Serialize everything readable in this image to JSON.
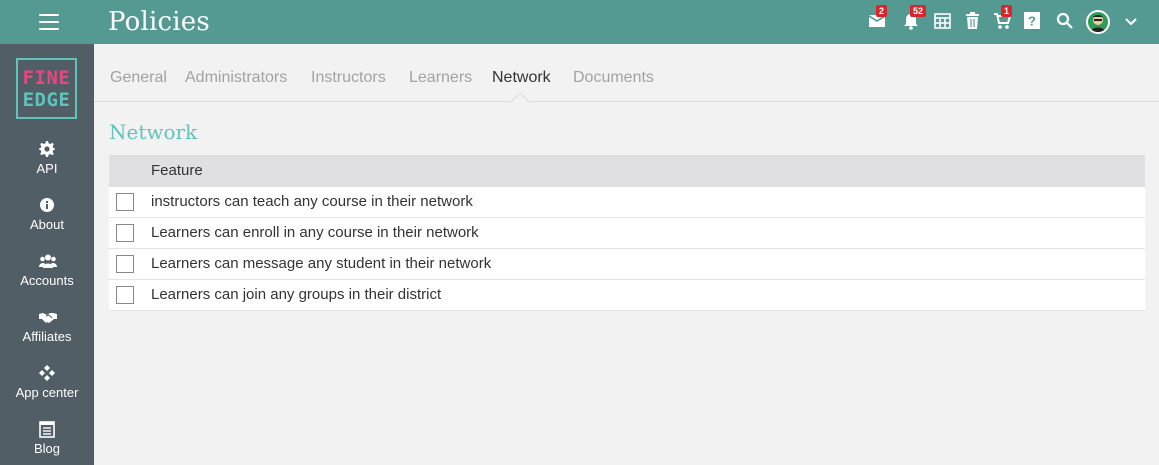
{
  "header": {
    "title": "Policies",
    "badges": {
      "messages": "2",
      "notifications": "52",
      "cart": "1"
    }
  },
  "sidebar": {
    "logo_line1": "FINE",
    "logo_line2": "EDGE",
    "items": [
      {
        "label": "API",
        "icon": "gear-icon"
      },
      {
        "label": "About",
        "icon": "info-icon"
      },
      {
        "label": "Accounts",
        "icon": "users-icon"
      },
      {
        "label": "Affiliates",
        "icon": "handshake-icon"
      },
      {
        "label": "App center",
        "icon": "app-center-icon"
      },
      {
        "label": "Blog",
        "icon": "blog-icon"
      }
    ]
  },
  "tabs": [
    {
      "label": "General"
    },
    {
      "label": "Administrators"
    },
    {
      "label": "Instructors"
    },
    {
      "label": "Learners"
    },
    {
      "label": "Network",
      "active": true
    },
    {
      "label": "Documents"
    }
  ],
  "section": {
    "title": "Network",
    "column_header": "Feature",
    "rows": [
      {
        "label": "instructors can teach any course in their network",
        "checked": false
      },
      {
        "label": "Learners can enroll in any course in their network",
        "checked": false
      },
      {
        "label": "Learners can message any student in their network",
        "checked": false
      },
      {
        "label": "Learners can join any groups in their district",
        "checked": false
      }
    ]
  },
  "colors": {
    "header_bg": "#559a92",
    "sidebar_bg": "#525e66",
    "accent": "#5ec4bc",
    "logo_pink": "#e6477f",
    "badge_red": "#d9262c"
  }
}
